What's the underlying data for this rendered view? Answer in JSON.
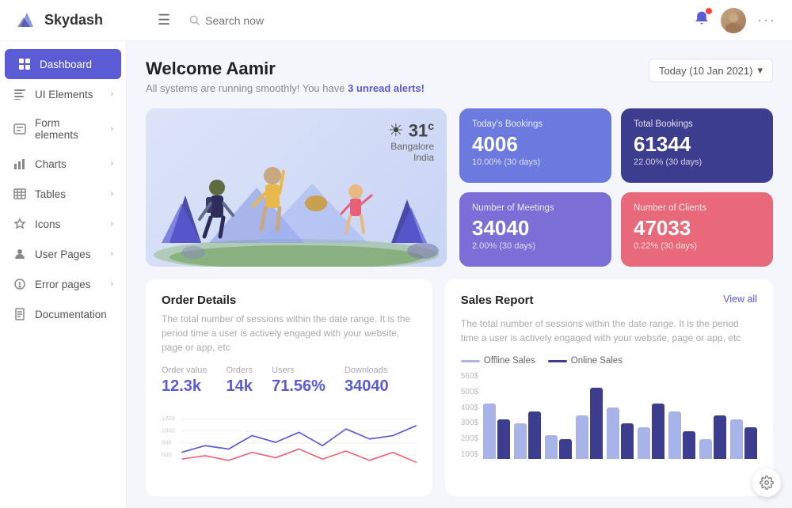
{
  "app": {
    "name": "Skydash"
  },
  "nav": {
    "search_placeholder": "Search now",
    "date": "Today (10 Jan 2021)"
  },
  "sidebar": {
    "items": [
      {
        "id": "dashboard",
        "label": "Dashboard",
        "active": true
      },
      {
        "id": "ui-elements",
        "label": "UI Elements",
        "hasArrow": true
      },
      {
        "id": "form-elements",
        "label": "Form elements",
        "hasArrow": true
      },
      {
        "id": "charts",
        "label": "Charts",
        "hasArrow": true
      },
      {
        "id": "tables",
        "label": "Tables",
        "hasArrow": true
      },
      {
        "id": "icons",
        "label": "Icons",
        "hasArrow": true
      },
      {
        "id": "user-pages",
        "label": "User Pages",
        "hasArrow": true
      },
      {
        "id": "error-pages",
        "label": "Error pages",
        "hasArrow": true
      },
      {
        "id": "documentation",
        "label": "Documentation"
      }
    ]
  },
  "header": {
    "welcome": "Welcome Aamir",
    "subtitle_prefix": "All systems are running smoothly! You have ",
    "alert_text": "3 unread alerts!",
    "subtitle_suffix": ""
  },
  "weather": {
    "temp": "31",
    "unit": "c",
    "city": "Bangalore",
    "country": "India"
  },
  "stats": [
    {
      "label": "Today's Bookings",
      "value": "4006",
      "sub": "10.00% (30 days)",
      "color": "blue"
    },
    {
      "label": "Total Bookings",
      "value": "61344",
      "sub": "22.00% (30 days)",
      "color": "darkblue"
    },
    {
      "label": "Number of Meetings",
      "value": "34040",
      "sub": "2.00% (30 days)",
      "color": "purple"
    },
    {
      "label": "Number of Clients",
      "value": "47033",
      "sub": "0.22% (30 days)",
      "color": "red"
    }
  ],
  "order_details": {
    "title": "Order Details",
    "desc": "The total number of sessions within the date range. It is the period time a user is actively engaged with your website, page or app, etc",
    "stats": [
      {
        "label": "Order value",
        "value": "12.3k"
      },
      {
        "label": "Orders",
        "value": "14k"
      },
      {
        "label": "Users",
        "value": "71.56%"
      },
      {
        "label": "Downloads",
        "value": "34040"
      }
    ]
  },
  "sales_report": {
    "title": "Sales Report",
    "view_all": "View all",
    "desc": "The total number of sessions within the date range. It is the period time a user is actively engaged with your website, page or app, etc",
    "legend": [
      {
        "label": "Offline Sales",
        "color": "#a8b4e8"
      },
      {
        "label": "Online Sales",
        "color": "#3d3d8f"
      }
    ],
    "y_labels": [
      "560$",
      "500$",
      "400$",
      "300$",
      "200$",
      "100$"
    ],
    "bars": [
      {
        "light": 70,
        "dark": 50
      },
      {
        "light": 45,
        "dark": 60
      },
      {
        "light": 30,
        "dark": 25
      },
      {
        "light": 55,
        "dark": 80
      },
      {
        "light": 65,
        "dark": 45
      },
      {
        "light": 40,
        "dark": 70
      },
      {
        "light": 60,
        "dark": 35
      },
      {
        "light": 25,
        "dark": 55
      },
      {
        "light": 50,
        "dark": 40
      }
    ]
  },
  "mini_chart": {
    "y_labels": [
      "1200",
      "1000",
      "800",
      "600"
    ],
    "line_color_1": "#5b5bd6",
    "line_color_2": "#e8697a"
  }
}
